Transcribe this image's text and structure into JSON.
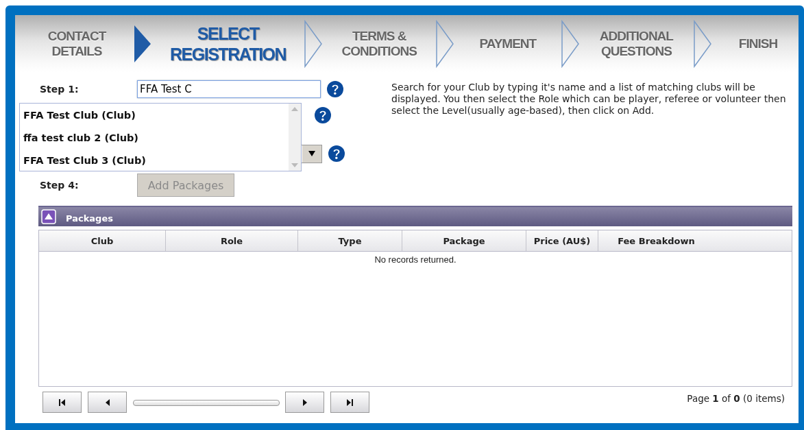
{
  "wizard": {
    "steps": [
      {
        "label": "CONTACT\nDETAILS",
        "selected": false
      },
      {
        "label": "SELECT\nREGISTRATION",
        "selected": true
      },
      {
        "label": "TERMS &\nCONDITIONS",
        "selected": false
      },
      {
        "label": "PAYMENT",
        "selected": false
      },
      {
        "label": "ADDITIONAL\nQUESTIONS",
        "selected": false
      },
      {
        "label": "FINISH",
        "selected": false
      }
    ]
  },
  "form": {
    "rows": [
      {
        "kind": "search",
        "label": "Step 1:",
        "value": "FFA Test C"
      },
      {
        "kind": "covered"
      },
      {
        "kind": "select"
      },
      {
        "kind": "button",
        "label": "Step 4:",
        "button": "Add Packages",
        "disabled": true
      }
    ],
    "suggestions": [
      {
        "text": "FFA Test Club (Club)",
        "selected": false
      },
      {
        "text": "ffa test club 2 (Club)",
        "selected": false
      },
      {
        "text": "FFA Test Club 3 (Club)",
        "selected": false
      }
    ],
    "help_text": "Search for your Club by typing it's name and a list of matching clubs will be displayed. You then select the Role which can be player, referee or volunteer then select the Level(usually age-based), then click on Add."
  },
  "packages": {
    "title": "Packages",
    "expanded": true,
    "columns": [
      "Club",
      "Role",
      "Type",
      "Package",
      "Price (AU$)",
      "Fee Breakdown"
    ],
    "empty_text": "No records returned.",
    "pager": {
      "summary": "Page **1** of **0** (0 items)"
    }
  }
}
